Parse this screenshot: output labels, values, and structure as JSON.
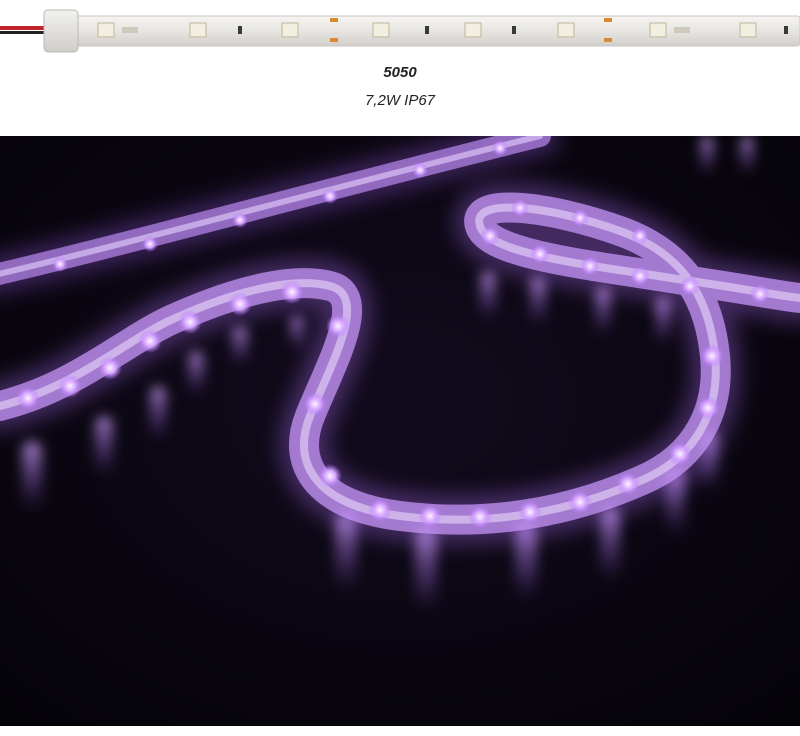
{
  "product": {
    "model": "5050",
    "spec": "7,2W IP67"
  },
  "colors": {
    "background": "#ffffff",
    "photo_background": "#050308",
    "led_glow": "#c98cff",
    "led_core": "#f4e6ff",
    "strip_body": "#e9e7e4",
    "wire_red": "#c0252a",
    "copper_pad": "#d98a30"
  }
}
